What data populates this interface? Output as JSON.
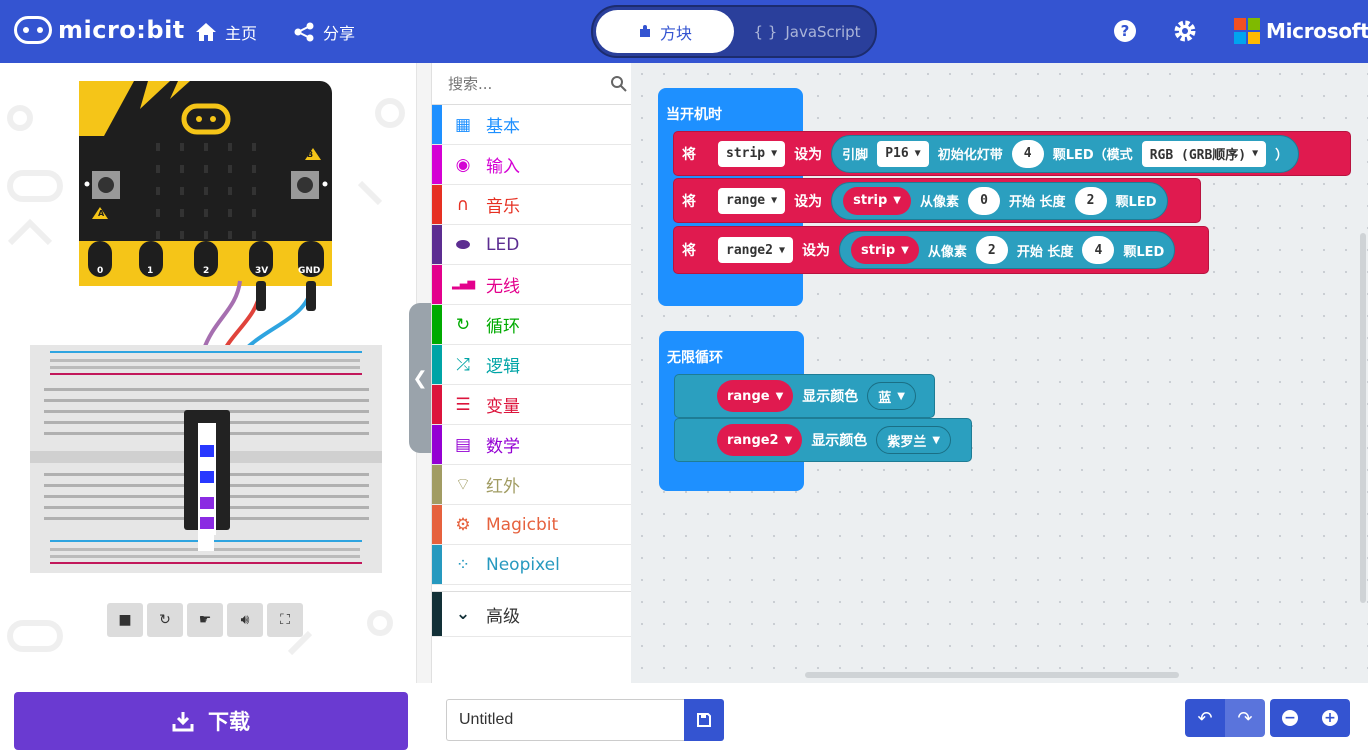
{
  "header": {
    "logo_text": "micro:bit",
    "home_label": "主页",
    "share_label": "分享",
    "tab_blocks": "方块",
    "tab_javascript": "JavaScript",
    "brand": "Microsoft",
    "bg_color": "#3454d1"
  },
  "simulator": {
    "pin_labels": [
      "0",
      "1",
      "2",
      "3V",
      "GND"
    ],
    "button_a": "A",
    "button_b": "B",
    "controls": [
      "stop-icon",
      "restart-icon",
      "slowmo-icon",
      "sound-icon",
      "fullscreen-icon"
    ]
  },
  "toolbox": {
    "search_placeholder": "搜索...",
    "categories": [
      {
        "label": "基本",
        "color": "#1e90ff",
        "icon": "grid-icon"
      },
      {
        "label": "输入",
        "color": "#d400d4",
        "icon": "target-icon"
      },
      {
        "label": "音乐",
        "color": "#e63022",
        "icon": "headphones-icon"
      },
      {
        "label": "LED",
        "color": "#5c2d91",
        "icon": "toggle-icon"
      },
      {
        "label": "无线",
        "color": "#e3008c",
        "icon": "signal-icon"
      },
      {
        "label": "循环",
        "color": "#00aa00",
        "icon": "refresh-icon"
      },
      {
        "label": "逻辑",
        "color": "#00a4a6",
        "icon": "shuffle-icon"
      },
      {
        "label": "变量",
        "color": "#dc143c",
        "icon": "lines-icon"
      },
      {
        "label": "数学",
        "color": "#9400d3",
        "icon": "calculator-icon"
      },
      {
        "label": "红外",
        "color": "#a19c63",
        "icon": "wifi-icon"
      },
      {
        "label": "Magicbit",
        "color": "#e6613d",
        "icon": "gear-icon"
      },
      {
        "label": "Neopixel",
        "color": "#2699bf",
        "icon": "dots-circle-icon"
      }
    ],
    "advanced_label": "高级"
  },
  "workspace": {
    "on_start": "当开机时",
    "forever": "无限循环",
    "set_word": "将",
    "to_word": "设为",
    "line1": {
      "var": "strip",
      "neopixel": "引脚",
      "pin": "P16",
      "init": "初始化灯带",
      "count": "4",
      "leds_mode": "颗LED（模式",
      "mode": "RGB (GRB顺序)",
      "close": "）"
    },
    "line2": {
      "var": "range",
      "src": "strip",
      "from": "从像素",
      "start": "0",
      "begin": "开始 长度",
      "len": "2",
      "unit": "颗LED"
    },
    "line3": {
      "var": "range2",
      "src": "strip",
      "from": "从像素",
      "start": "2",
      "begin": "开始 长度",
      "len": "4",
      "unit": "颗LED"
    },
    "loop1": {
      "var": "range",
      "action": "显示颜色",
      "color": "蓝"
    },
    "loop2": {
      "var": "range2",
      "action": "显示颜色",
      "color": "紫罗兰"
    }
  },
  "bottom": {
    "download_label": "下载",
    "project_name": "Untitled"
  }
}
